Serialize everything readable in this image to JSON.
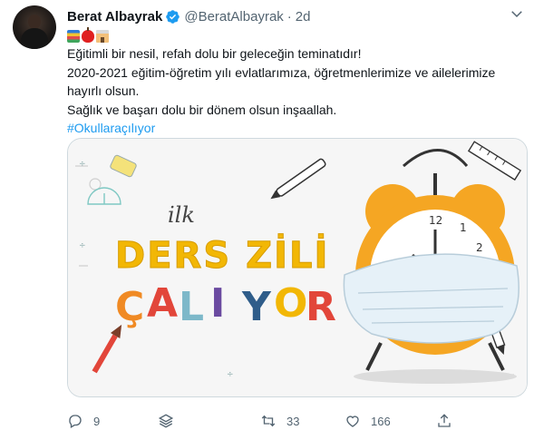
{
  "tweet": {
    "author_name": "Berat Albayrak",
    "handle": "@BeratAlbayrak",
    "separator": "·",
    "time": "2d",
    "emojis": [
      "books-emoji",
      "apple-emoji",
      "school-emoji"
    ],
    "lines": [
      "Eğitimli bir nesil, refah dolu bir geleceğin teminatıdır!",
      "2020-2021 eğitim-öğretim yılı evlatlarımıza, öğretmenlerimize ve ailelerimize hayırlı olsun.",
      "Sağlık ve başarı dolu bir dönem olsun inşaallah."
    ],
    "hashtag": "#Okullaraçılıyor"
  },
  "image": {
    "script_text": "ilk",
    "headline": "DERS ZİLİ",
    "subline": "ÇALIYOR",
    "clock_numbers": [
      "12",
      "1",
      "2"
    ],
    "colors": {
      "headline": "#f2b705",
      "subline_letters": [
        "#f08a24",
        "#e2463a",
        "#7db8c9",
        "#6a4aa0",
        "#2f5d8a",
        "#f2b705",
        "#e2463a"
      ],
      "bell": "#f5a623",
      "mask": "#e6f1f8"
    }
  },
  "actions": {
    "replies": "9",
    "retweets": "33",
    "likes": "166"
  },
  "icons": [
    "verified-badge-icon",
    "caret-down-icon",
    "reply-icon",
    "stack-icon",
    "retweet-icon",
    "like-icon",
    "share-icon"
  ]
}
